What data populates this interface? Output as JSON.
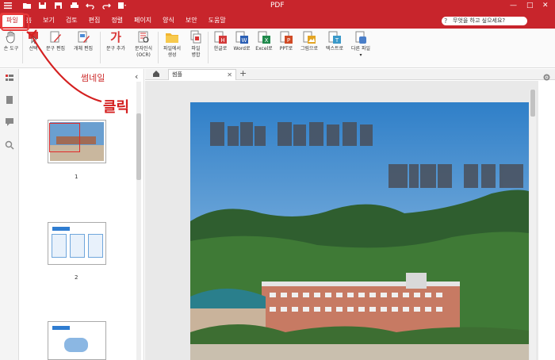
{
  "app": {
    "title": "PDF",
    "colors": {
      "accent": "#c8252c",
      "annotation": "#d42020"
    }
  },
  "menu": {
    "items": [
      {
        "label": "파일",
        "active": true
      },
      {
        "label": "홈"
      },
      {
        "label": "보기"
      },
      {
        "label": "검토"
      },
      {
        "label": "편집"
      },
      {
        "label": "정렬"
      },
      {
        "label": "페이지"
      },
      {
        "label": "양식"
      },
      {
        "label": "보안"
      },
      {
        "label": "도움말"
      }
    ],
    "help_placeholder": "무엇을 하고 싶으세요?"
  },
  "ribbon": {
    "buttons": [
      {
        "label": "손 도구",
        "icon": "hand-icon"
      },
      {
        "label": "선택",
        "icon": "cursor-icon"
      },
      {
        "label": "문구 편집",
        "icon": "edit-text-icon"
      },
      {
        "label": "개체 편집",
        "icon": "edit-object-icon"
      },
      {
        "label": "문구 추가",
        "icon": "add-text-icon"
      },
      {
        "label": "문자인식",
        "label2": "(OCR)",
        "icon": "ocr-icon"
      },
      {
        "label": "파일에서",
        "label2": "생성",
        "icon": "folder-icon"
      },
      {
        "label": "파일",
        "label2": "병합",
        "icon": "merge-icon"
      },
      {
        "label": "한글로",
        "icon": "hwp-icon",
        "color": "#d33a3a"
      },
      {
        "label": "Word로",
        "icon": "word-icon",
        "color": "#2b5fb4"
      },
      {
        "label": "Excel로",
        "icon": "excel-icon",
        "color": "#1f8a4c"
      },
      {
        "label": "PPT로",
        "icon": "ppt-icon",
        "color": "#d04a25"
      },
      {
        "label": "그림으로",
        "icon": "image-icon",
        "color": "#e3a423"
      },
      {
        "label": "텍스트로",
        "icon": "text-file-icon",
        "color": "#3a99c9"
      },
      {
        "label": "다른 파일",
        "icon": "other-file-icon",
        "color": "#4a7fc9"
      }
    ]
  },
  "thumbnails": {
    "title": "썸네일",
    "pages": [
      "1",
      "2"
    ]
  },
  "tabs": {
    "doc_tab": "썸플"
  },
  "annotation": {
    "text": "클릭"
  }
}
